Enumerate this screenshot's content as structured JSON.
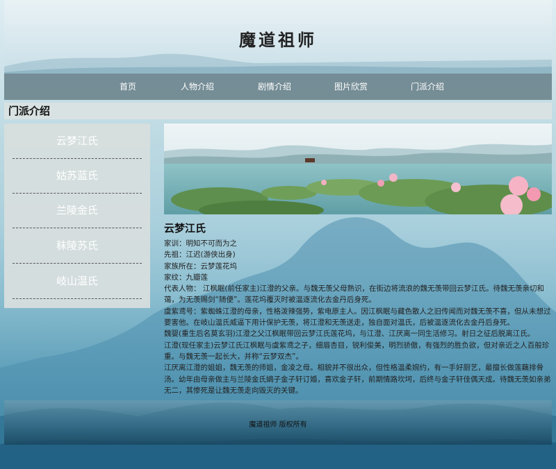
{
  "header": {
    "title": "魔道祖师"
  },
  "nav": {
    "items": [
      "首页",
      "人物介绍",
      "剧情介绍",
      "图片欣赏",
      "门派介绍"
    ]
  },
  "section": {
    "title": "门派介绍"
  },
  "sidebar": {
    "items": [
      "云梦江氏",
      "姑苏蓝氏",
      "兰陵金氏",
      "秣陵苏氏",
      "岐山温氏"
    ]
  },
  "main": {
    "clan_name": "云梦江氏",
    "lines": [
      "家训：明知不可而为之",
      "先祖：江迟(游侠出身)",
      "家族所在：云梦莲花坞",
      "家纹：九瓣莲",
      "代表人物： 江枫眠(前任家主)江澄的父亲。与魏无羡父母熟识，在街边将流浪的魏无羡带回云梦江氏。待魏无羡亲切和蔼，为无羡赐剑“随便”。莲花坞覆灭时被温逐流化去金丹后身死。",
      "虞紫鸢号：紫蜘蛛江澄的母亲，性格泼辣强势，紫电原主人。因江枫眠与藏色散人之旧传闻而对魏无羡不喜，但从未想过要害他。在岐山温氏威逼下用计保护无羡，将江澄和无羡送走，独自面对温氏，后被温逐流化去金丹后身死。",
      "魏婴(重生后名莫玄羽)江澄之父江枫眠带回云梦江氏莲花坞，与江澄、江厌离一同生活修习。射日之征后脱离江氏。",
      "江澄(现任家主)云梦江氏江枫眠与虞紫鸢之子，细眉杏目，锐利俊美，明烈骄傲，有强烈的胜负欲，但对亲近之人百般珍重。与魏无羡一起长大，并称“云梦双杰”。",
      "江厌离江澄的姐姐，魏无羡的师姐，金凌之母。相貌并不很出众，但性格温柔婉约，有一手好厨艺，最擅长做莲藕排骨汤。幼年由母亲做主与兰陵金氏嫡子金子轩订婚，喜欢金子轩，前期情路坎坷，后终与金子轩佳偶天成。待魏无羡如亲弟无二，其惨死是让魏无羡走向毁灭的关键。"
    ]
  },
  "footer": {
    "text": "魔道祖师 版权所有"
  },
  "colors": {
    "nav_bg": "#6e868e",
    "sidebar_bg": "#d6dede",
    "page_bg_top": "#dfeef3",
    "page_bg_bottom": "#2d7898"
  }
}
